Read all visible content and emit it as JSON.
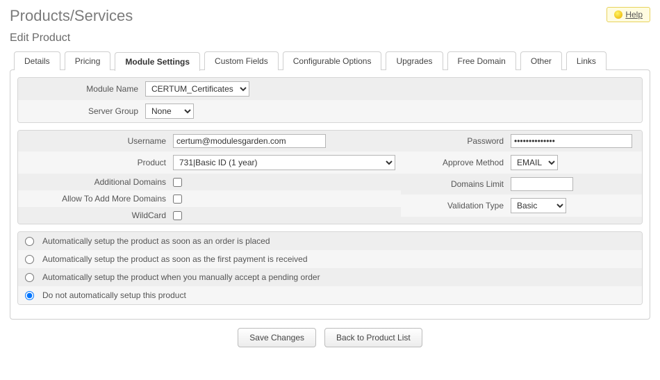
{
  "page": {
    "title": "Products/Services",
    "subtitle": "Edit Product",
    "help_label": "Help"
  },
  "tabs": {
    "details": "Details",
    "pricing": "Pricing",
    "module_settings": "Module Settings",
    "custom_fields": "Custom Fields",
    "configurable_options": "Configurable Options",
    "upgrades": "Upgrades",
    "free_domain": "Free Domain",
    "other": "Other",
    "links": "Links"
  },
  "module": {
    "name_label": "Module Name",
    "name_value": "CERTUM_Certificates",
    "server_group_label": "Server Group",
    "server_group_value": "None"
  },
  "fields": {
    "username_label": "Username",
    "username_value": "certum@modulesgarden.com",
    "product_label": "Product",
    "product_value": "731|Basic ID (1 year)",
    "additional_domains_label": "Additional Domains",
    "allow_more_domains_label": "Allow To Add More Domains",
    "wildcard_label": "WildCard",
    "password_label": "Password",
    "password_value": "••••••••••••••",
    "approve_label": "Approve Method",
    "approve_value": "EMAIL",
    "domains_limit_label": "Domains Limit",
    "domains_limit_value": "",
    "validation_label": "Validation Type",
    "validation_value": "Basic"
  },
  "autosetup": {
    "opt1": "Automatically setup the product as soon as an order is placed",
    "opt2": "Automatically setup the product as soon as the first payment is received",
    "opt3": "Automatically setup the product when you manually accept a pending order",
    "opt4": "Do not automatically setup this product"
  },
  "buttons": {
    "save": "Save Changes",
    "back": "Back to Product List"
  }
}
